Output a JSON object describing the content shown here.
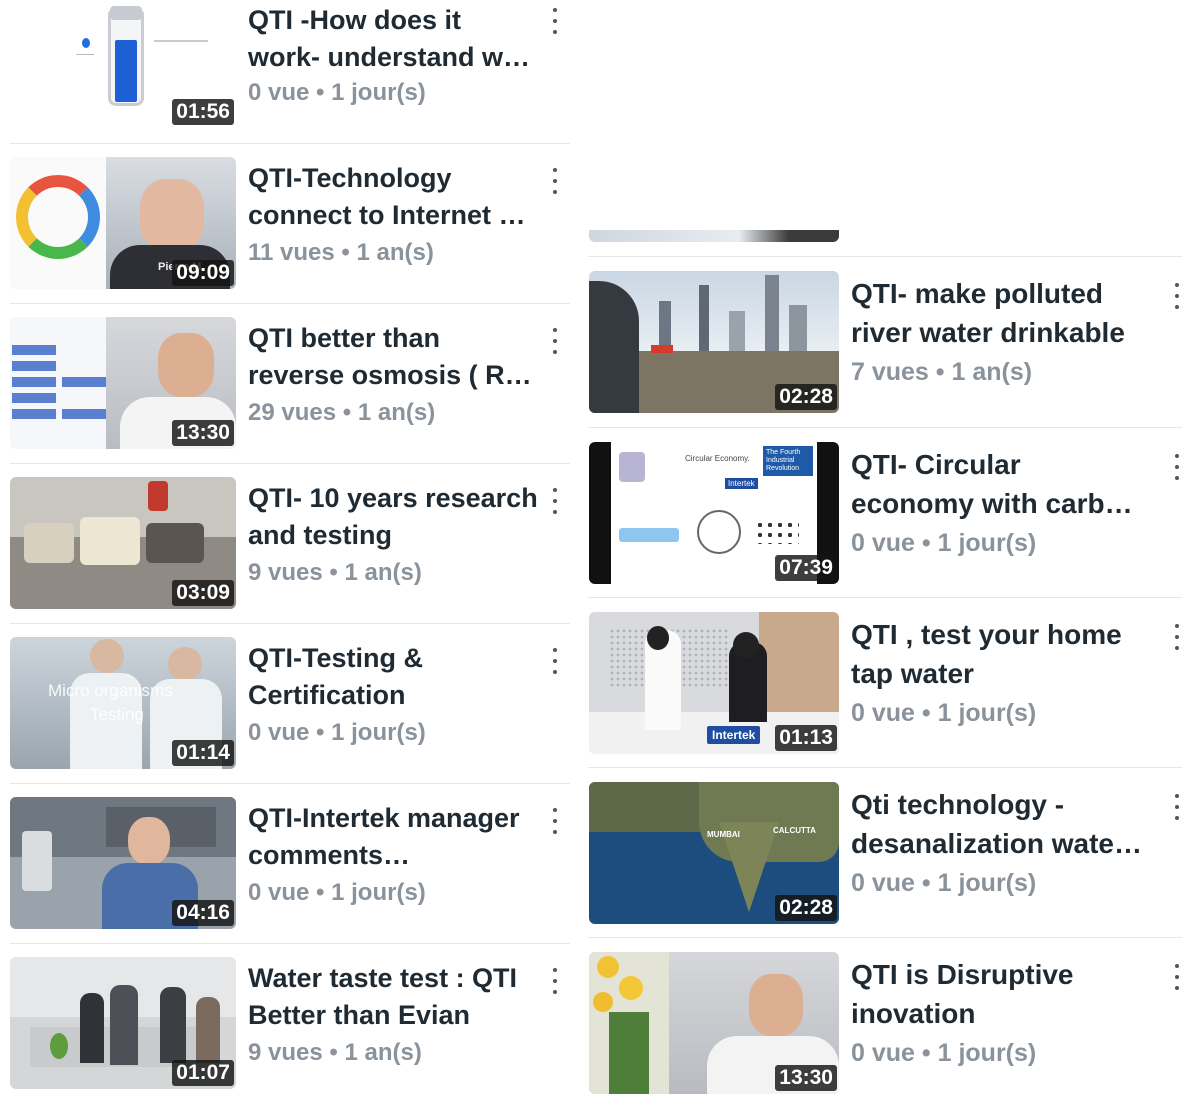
{
  "left_videos": [
    {
      "title": "QTI -How does it work- understand w…",
      "views": "0 vue",
      "age": "1 jour(s)",
      "duration": "01:56"
    },
    {
      "title": "QTI-Technology connect to Internet …",
      "views": "11 vues",
      "age": "1 an(s)",
      "duration": "09:09"
    },
    {
      "title": "QTI better than reverse osmosis ( R…",
      "views": "29 vues",
      "age": "1 an(s)",
      "duration": "13:30"
    },
    {
      "title": "QTI- 10 years research and testing",
      "views": "9 vues",
      "age": "1 an(s)",
      "duration": "03:09"
    },
    {
      "title": "QTI-Testing & Certification",
      "views": "0 vue",
      "age": "1 jour(s)",
      "duration": "01:14"
    },
    {
      "title": "QTI-Intertek manager comments…",
      "views": "0 vue",
      "age": "1 jour(s)",
      "duration": "04:16"
    },
    {
      "title": "Water taste test : QTI Better than Evian",
      "views": "9 vues",
      "age": "1 an(s)",
      "duration": "01:07"
    }
  ],
  "right_videos": [
    {
      "title": "QTI- make polluted river water drinkable",
      "views": "7 vues",
      "age": "1 an(s)",
      "duration": "02:28"
    },
    {
      "title": "QTI- Circular economy with carb…",
      "views": "0 vue",
      "age": "1 jour(s)",
      "duration": "07:39"
    },
    {
      "title": "QTI ,  test your home tap water",
      "views": "0 vue",
      "age": "1 jour(s)",
      "duration": "01:13"
    },
    {
      "title": "Qti technology - desanalization wate…",
      "views": "0 vue",
      "age": "1 jour(s)",
      "duration": "02:28"
    },
    {
      "title": "QTI is Disruptive inovation",
      "views": "0 vue",
      "age": "1 jour(s)",
      "duration": "13:30"
    }
  ],
  "thumb_text": {
    "micro": "Micro organisms",
    "testing": "Testing",
    "pierre": "Pierre M",
    "circular": "Circular Economy.",
    "fourth": "The Fourth Industrial Revolution",
    "intertek": "Intertek",
    "mumbai": "MUMBAI",
    "calcutta": "CALCUTTA"
  },
  "separator": "•"
}
